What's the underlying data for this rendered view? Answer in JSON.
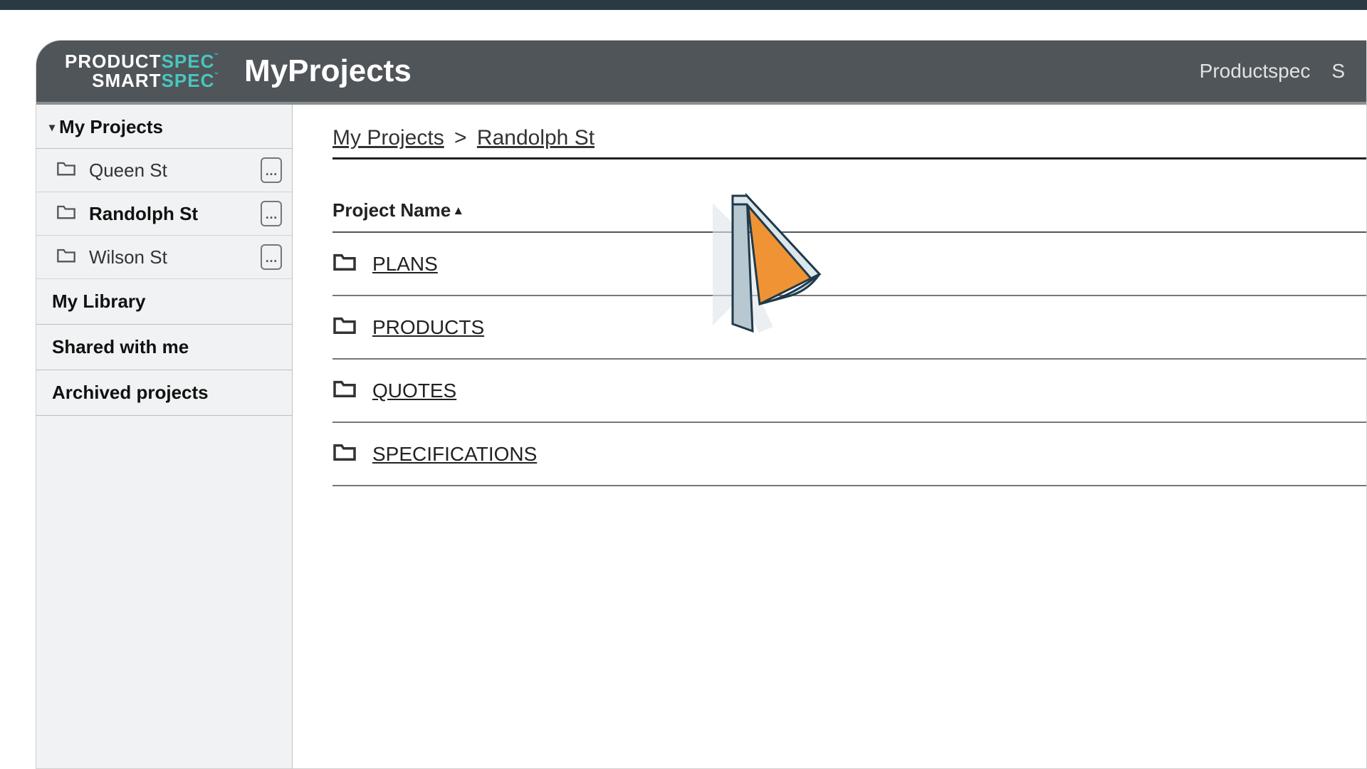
{
  "header": {
    "brand_top_a": "PRODUCT",
    "brand_top_b": "SPEC",
    "brand_bot_a": "SMART",
    "brand_bot_b": "SPEC",
    "app_title": "MyProjects",
    "nav": [
      "Productspec",
      "S"
    ]
  },
  "sidebar": {
    "section_title": "My Projects",
    "projects": [
      {
        "name": "Queen St",
        "active": false
      },
      {
        "name": "Randolph St",
        "active": true
      },
      {
        "name": "Wilson St",
        "active": false
      }
    ],
    "links": [
      "My Library",
      "Shared with me",
      "Archived projects"
    ]
  },
  "breadcrumb": {
    "root": "My Projects",
    "current": "Randolph St"
  },
  "table": {
    "column_header": "Project Name",
    "sort_dir": "asc",
    "rows": [
      "PLANS",
      "PRODUCTS",
      "QUOTES",
      "SPECIFICATIONS"
    ]
  }
}
